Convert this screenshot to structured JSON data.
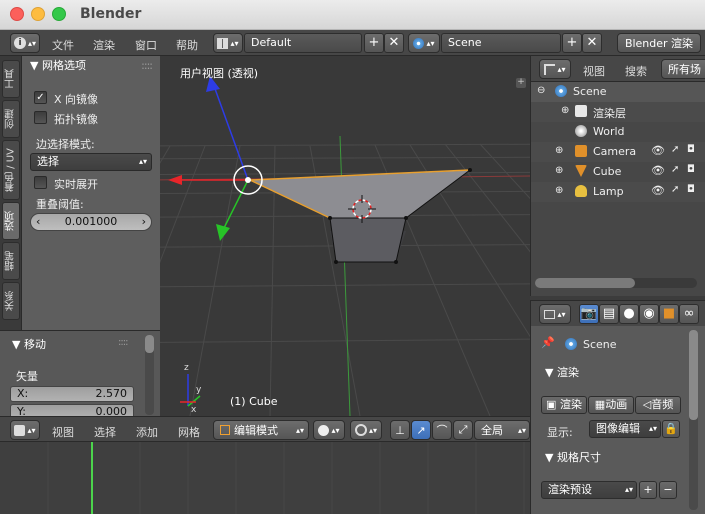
{
  "window": {
    "title": "Blender"
  },
  "topbar": {
    "info_icon": "info-icon",
    "menus": [
      "文件",
      "渲染",
      "窗口",
      "帮助"
    ],
    "layout_name": "Default",
    "scene_name": "Scene",
    "engine": "Blender 渲染"
  },
  "tool_tabs": [
    "工具",
    "创建",
    "着色 / UV",
    "选项",
    "蜡笔",
    "关系"
  ],
  "mesh_options": {
    "header": "网格选项",
    "x_mirror_label": "X 向镜像",
    "x_mirror_checked": true,
    "topology_mirror_label": "拓扑镜像",
    "topology_mirror_checked": false,
    "edge_select_label": "边选择模式:",
    "edge_select_value": "选择",
    "live_unwrap_label": "实时展开",
    "live_unwrap_checked": false,
    "double_threshold_label": "重叠阈值:",
    "double_threshold_value": "0.001000"
  },
  "operator_panel": {
    "header": "移动",
    "vector_label": "矢量",
    "x_label": "X:",
    "x_value": "2.570",
    "y_label": "Y:",
    "y_value": "0.000"
  },
  "viewport": {
    "view_label": "用户视图 (透视)",
    "object_label": "(1) Cube",
    "colors": {
      "x_axis": "#e8252a",
      "y_axis": "#27c427",
      "z_axis": "#2d3ce6",
      "mesh_face": "#8d8d92"
    }
  },
  "bottombar": {
    "menus": [
      "视图",
      "选择",
      "添加",
      "网格"
    ],
    "mode": "编辑模式",
    "pivot": "全局"
  },
  "outliner": {
    "header_menus": [
      "视图",
      "搜索"
    ],
    "filter_label": "所有场",
    "rows": [
      {
        "name": "Scene",
        "icon": "scene-icon"
      },
      {
        "name": "渲染层",
        "icon": "render-layers-icon"
      },
      {
        "name": "World",
        "icon": "world-icon"
      },
      {
        "name": "Camera",
        "icon": "camera-icon"
      },
      {
        "name": "Cube",
        "icon": "mesh-icon"
      },
      {
        "name": "Lamp",
        "icon": "lamp-icon"
      }
    ]
  },
  "properties": {
    "scene_path": "Scene",
    "render_header": "渲染",
    "render_buttons": [
      "渲染",
      "动画",
      "音频"
    ],
    "display_label": "显示:",
    "display_value": "图像编辑",
    "dimensions_header": "规格尺寸",
    "preset_label": "渲染预设"
  }
}
